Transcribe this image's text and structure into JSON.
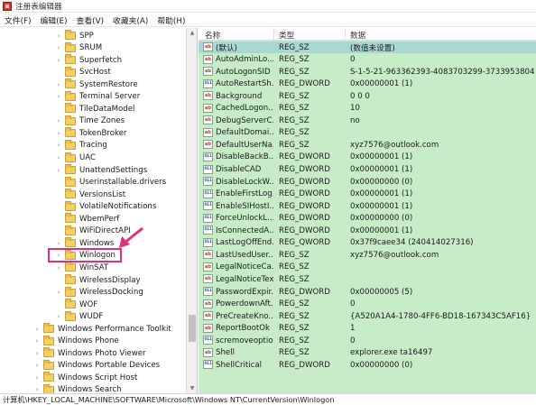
{
  "window": {
    "title": "注册表编辑器"
  },
  "menu": [
    "文件(F)",
    "编辑(E)",
    "查看(V)",
    "收藏夹(A)",
    "帮助(H)"
  ],
  "tree": {
    "items": [
      {
        "label": "SPP",
        "expander": "›"
      },
      {
        "label": "SRUM",
        "expander": "›"
      },
      {
        "label": "Superfetch",
        "expander": "›"
      },
      {
        "label": "SvcHost",
        "expander": ""
      },
      {
        "label": "SystemRestore",
        "expander": "›"
      },
      {
        "label": "Terminal Server",
        "expander": "›"
      },
      {
        "label": "TileDataModel",
        "expander": ""
      },
      {
        "label": "Time Zones",
        "expander": "›"
      },
      {
        "label": "TokenBroker",
        "expander": "›"
      },
      {
        "label": "Tracing",
        "expander": "›"
      },
      {
        "label": "UAC",
        "expander": "›"
      },
      {
        "label": "UnattendSettings",
        "expander": "›"
      },
      {
        "label": "Userinstallable.drivers",
        "expander": ""
      },
      {
        "label": "VersionsList",
        "expander": ""
      },
      {
        "label": "VolatileNotifications",
        "expander": ""
      },
      {
        "label": "WbemPerf",
        "expander": ""
      },
      {
        "label": "WiFiDirectAPI",
        "expander": ""
      },
      {
        "label": "Windows",
        "expander": "›"
      },
      {
        "label": "Winlogon",
        "expander": "›"
      },
      {
        "label": "WinSAT",
        "expander": "›"
      },
      {
        "label": "WirelessDisplay",
        "expander": ""
      },
      {
        "label": "WirelessDocking",
        "expander": "›"
      },
      {
        "label": "WOF",
        "expander": ""
      },
      {
        "label": "WUDF",
        "expander": "›"
      }
    ],
    "root_items": [
      {
        "label": "Windows Performance Toolkit",
        "expander": "›"
      },
      {
        "label": "Windows Phone",
        "expander": "›"
      },
      {
        "label": "Windows Photo Viewer",
        "expander": "›"
      },
      {
        "label": "Windows Portable Devices",
        "expander": "›"
      },
      {
        "label": "Windows Script Host",
        "expander": "›"
      },
      {
        "label": "Windows Search",
        "expander": "›"
      }
    ],
    "highlight_color": "#e0307a"
  },
  "list": {
    "columns": [
      "名称",
      "类型",
      "数据"
    ],
    "rows": [
      {
        "icon": "string-icon",
        "icon_text": "ab",
        "name": "(默认)",
        "type": "REG_SZ",
        "data": "(数值未设置)"
      },
      {
        "icon": "string-icon",
        "icon_text": "ab",
        "name": "AutoAdminLo...",
        "type": "REG_SZ",
        "data": "0"
      },
      {
        "icon": "string-icon",
        "icon_text": "ab",
        "name": "AutoLogonSID",
        "type": "REG_SZ",
        "data": "S-1-5-21-963362393-4083703299-3733953804-1001"
      },
      {
        "icon": "binary-icon",
        "icon_text": "011",
        "name": "AutoRestartSh...",
        "type": "REG_DWORD",
        "data": "0x00000001 (1)"
      },
      {
        "icon": "string-icon",
        "icon_text": "ab",
        "name": "Background",
        "type": "REG_SZ",
        "data": "0 0 0"
      },
      {
        "icon": "string-icon",
        "icon_text": "ab",
        "name": "CachedLogon...",
        "type": "REG_SZ",
        "data": "10"
      },
      {
        "icon": "string-icon",
        "icon_text": "ab",
        "name": "DebugServerC...",
        "type": "REG_SZ",
        "data": "no"
      },
      {
        "icon": "string-icon",
        "icon_text": "ab",
        "name": "DefaultDomai...",
        "type": "REG_SZ",
        "data": ""
      },
      {
        "icon": "string-icon",
        "icon_text": "ab",
        "name": "DefaultUserNa...",
        "type": "REG_SZ",
        "data": "xyz7576@outlook.com"
      },
      {
        "icon": "binary-icon",
        "icon_text": "011",
        "name": "DisableBackB...",
        "type": "REG_DWORD",
        "data": "0x00000001 (1)"
      },
      {
        "icon": "binary-icon",
        "icon_text": "011",
        "name": "DisableCAD",
        "type": "REG_DWORD",
        "data": "0x00000001 (1)"
      },
      {
        "icon": "binary-icon",
        "icon_text": "011",
        "name": "DisableLockW...",
        "type": "REG_DWORD",
        "data": "0x00000000 (0)"
      },
      {
        "icon": "binary-icon",
        "icon_text": "011",
        "name": "EnableFirstLog...",
        "type": "REG_DWORD",
        "data": "0x00000001 (1)"
      },
      {
        "icon": "binary-icon",
        "icon_text": "011",
        "name": "EnableSIHostI...",
        "type": "REG_DWORD",
        "data": "0x00000001 (1)"
      },
      {
        "icon": "binary-icon",
        "icon_text": "011",
        "name": "ForceUnlockL...",
        "type": "REG_DWORD",
        "data": "0x00000000 (0)"
      },
      {
        "icon": "binary-icon",
        "icon_text": "011",
        "name": "IsConnectedA...",
        "type": "REG_DWORD",
        "data": "0x00000001 (1)"
      },
      {
        "icon": "binary-icon",
        "icon_text": "011",
        "name": "LastLogOffEnd...",
        "type": "REG_QWORD",
        "data": "0x37f9caee34 (240414027316)"
      },
      {
        "icon": "string-icon",
        "icon_text": "ab",
        "name": "LastUsedUser...",
        "type": "REG_SZ",
        "data": "xyz7576@outlook.com"
      },
      {
        "icon": "string-icon",
        "icon_text": "ab",
        "name": "LegalNoticeCa...",
        "type": "REG_SZ",
        "data": ""
      },
      {
        "icon": "string-icon",
        "icon_text": "ab",
        "name": "LegalNoticeText",
        "type": "REG_SZ",
        "data": ""
      },
      {
        "icon": "binary-icon",
        "icon_text": "011",
        "name": "PasswordExpir...",
        "type": "REG_DWORD",
        "data": "0x00000005 (5)"
      },
      {
        "icon": "string-icon",
        "icon_text": "ab",
        "name": "PowerdownAft...",
        "type": "REG_SZ",
        "data": "0"
      },
      {
        "icon": "string-icon",
        "icon_text": "ab",
        "name": "PreCreateKno...",
        "type": "REG_SZ",
        "data": "{A520A1A4-1780-4FF6-BD18-167343C5AF16}"
      },
      {
        "icon": "string-icon",
        "icon_text": "ab",
        "name": "ReportBootOk",
        "type": "REG_SZ",
        "data": "1"
      },
      {
        "icon": "binary-icon",
        "icon_text": "011",
        "name": "scremoveoption",
        "type": "REG_SZ",
        "data": "0"
      },
      {
        "icon": "string-icon",
        "icon_text": "ab",
        "name": "Shell",
        "type": "REG_SZ",
        "data": "explorer.exe ta16497"
      },
      {
        "icon": "binary-icon",
        "icon_text": "011",
        "name": "ShellCritical",
        "type": "REG_DWORD",
        "data": "0x00000000 (0)"
      }
    ],
    "selected_index": 0,
    "background_color": "#c7ecc7"
  },
  "statusbar": {
    "path": "计算机\\HKEY_LOCAL_MACHINE\\SOFTWARE\\Microsoft\\Windows NT\\CurrentVersion\\Winlogon"
  }
}
